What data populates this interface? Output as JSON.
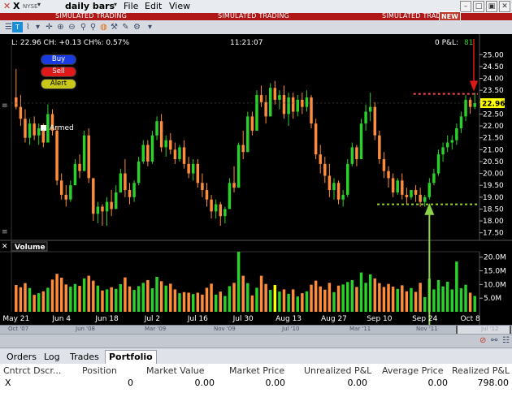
{
  "menu": {
    "symbol": "X",
    "exchange": "NYSE",
    "bar_type": "daily bars",
    "items": [
      "File",
      "Edit",
      "View"
    ]
  },
  "banner": {
    "text": "SIMULATED TRADING",
    "badge": "NEW"
  },
  "info": {
    "quote": "L: 22.96  CH: +0.13  CH%: 0.57%",
    "time": "11:21:07",
    "pnl_label": "0  P&L:",
    "pnl_value": "81"
  },
  "order_buttons": {
    "buy": "Buy",
    "sell": "Sell",
    "alert": "Alert",
    "armed": "Armed"
  },
  "colors": {
    "up": "#2bd12b",
    "down": "#ff8c3a",
    "highlight": "#ffff00",
    "resistance": "#ff4a4a",
    "support": "#9ad61f",
    "arrow_down": "#e01818",
    "arrow_up": "#8ad24a",
    "buy": "#1a3be0",
    "sell": "#e01a1a",
    "alert": "#c8c81a"
  },
  "price_axis": {
    "ticks": [
      "25.00",
      "24.50",
      "24.00",
      "23.50",
      "23.00",
      "22.50",
      "22.00",
      "21.50",
      "21.00",
      "20.50",
      "20.00",
      "19.50",
      "19.00",
      "18.50",
      "18.00",
      "17.50"
    ],
    "last_price_label": "22.96",
    "min": 17.25,
    "max": 25.25
  },
  "volume": {
    "label": "Volume",
    "ticks": [
      "20.0M",
      "15.0M",
      "10.0M",
      "5.0M"
    ],
    "max": 22
  },
  "x_labels": [
    "May 21",
    "Jun 4",
    "Jun 18",
    "Jul 2",
    "Jul 16",
    "Jul 30",
    "Aug 13",
    "Aug 27",
    "Sep 10",
    "Sep 24",
    "Oct 8"
  ],
  "navigator": {
    "labels": [
      "Oct '07",
      "Jun '08",
      "Mar '09",
      "Nov '09",
      "Jul '10",
      "Mar '11",
      "Nov '11",
      "Jul '12"
    ]
  },
  "portfolio": {
    "tabs": [
      "Orders",
      "Log",
      "Trades",
      "Portfolio"
    ],
    "active_tab": "Portfolio",
    "headers": [
      "Cntrct Dscr...",
      "Position",
      "Market Value",
      "Market Price",
      "Unrealized P&L",
      "Average Price",
      "Realized P&L"
    ],
    "row": [
      "X",
      "0",
      "0.00",
      "0.00",
      "0.00",
      "0.00",
      "798.00"
    ]
  },
  "chart_data": {
    "type": "candlestick",
    "resistance": 23.35,
    "support": 18.7,
    "candles": [
      [
        23.2,
        24.4,
        22.7,
        22.8,
        9.8
      ],
      [
        22.8,
        23.3,
        22.0,
        22.3,
        9.0
      ],
      [
        22.3,
        22.7,
        21.3,
        21.5,
        10.5
      ],
      [
        21.5,
        22.3,
        21.2,
        22.1,
        8.7
      ],
      [
        22.1,
        22.4,
        21.4,
        21.6,
        6.2
      ],
      [
        21.6,
        22.1,
        21.2,
        21.9,
        6.8
      ],
      [
        21.9,
        22.1,
        21.1,
        21.3,
        7.5
      ],
      [
        21.3,
        22.9,
        21.3,
        22.5,
        8.8
      ],
      [
        22.5,
        22.7,
        21.6,
        21.8,
        11.8
      ],
      [
        21.8,
        22.0,
        19.5,
        19.7,
        13.9
      ],
      [
        19.7,
        20.0,
        18.9,
        19.1,
        12.5
      ],
      [
        19.1,
        19.5,
        18.6,
        18.9,
        10.0
      ],
      [
        18.9,
        19.7,
        18.8,
        19.5,
        9.2
      ],
      [
        19.5,
        20.6,
        19.5,
        20.4,
        10.2
      ],
      [
        20.4,
        20.8,
        19.8,
        20.1,
        9.5
      ],
      [
        20.1,
        21.8,
        20.1,
        21.6,
        12.2
      ],
      [
        21.6,
        21.9,
        19.6,
        19.8,
        13.2
      ],
      [
        19.8,
        19.8,
        18.0,
        18.3,
        11.4
      ],
      [
        18.3,
        18.8,
        17.9,
        18.6,
        9.6
      ],
      [
        18.6,
        18.7,
        17.8,
        18.4,
        7.8
      ],
      [
        18.4,
        19.0,
        17.8,
        18.8,
        8.2
      ],
      [
        18.8,
        19.3,
        18.2,
        18.5,
        9.0
      ],
      [
        18.5,
        19.5,
        18.5,
        19.2,
        8.4
      ],
      [
        19.2,
        20.2,
        19.2,
        20.0,
        10.1
      ],
      [
        20.0,
        20.6,
        19.0,
        19.3,
        12.6
      ],
      [
        19.3,
        19.6,
        18.7,
        19.0,
        9.3
      ],
      [
        19.0,
        19.7,
        18.8,
        19.6,
        8.0
      ],
      [
        19.6,
        20.7,
        19.5,
        20.5,
        9.4
      ],
      [
        20.5,
        21.4,
        20.4,
        21.2,
        10.6
      ],
      [
        21.2,
        21.4,
        20.3,
        20.5,
        11.6
      ],
      [
        20.5,
        21.8,
        20.4,
        21.6,
        8.6
      ],
      [
        21.6,
        22.4,
        21.4,
        22.2,
        12.8
      ],
      [
        22.2,
        22.5,
        20.9,
        21.1,
        11.2
      ],
      [
        21.1,
        21.6,
        20.7,
        21.4,
        9.6
      ],
      [
        21.4,
        21.7,
        20.8,
        21.0,
        10.3
      ],
      [
        21.0,
        21.3,
        20.4,
        20.6,
        8.2
      ],
      [
        20.6,
        21.2,
        20.5,
        21.1,
        6.8
      ],
      [
        21.1,
        21.4,
        20.2,
        20.4,
        7.2
      ],
      [
        20.4,
        20.7,
        19.8,
        20.0,
        7.0
      ],
      [
        20.0,
        20.6,
        19.7,
        20.4,
        6.5
      ],
      [
        20.4,
        20.6,
        19.4,
        19.6,
        7.0
      ],
      [
        19.6,
        20.0,
        19.0,
        19.3,
        6.3
      ],
      [
        19.3,
        19.6,
        18.6,
        18.9,
        8.8
      ],
      [
        18.9,
        19.1,
        18.1,
        18.4,
        10.3
      ],
      [
        18.4,
        18.9,
        18.1,
        18.7,
        6.3
      ],
      [
        18.7,
        18.8,
        17.8,
        18.2,
        7.4
      ],
      [
        18.2,
        18.6,
        17.9,
        18.5,
        5.8
      ],
      [
        18.5,
        19.8,
        18.5,
        19.6,
        9.4
      ],
      [
        19.6,
        20.3,
        19.2,
        19.4,
        10.6
      ],
      [
        19.4,
        21.3,
        19.4,
        21.2,
        22.0
      ],
      [
        21.2,
        21.8,
        20.6,
        20.9,
        13.2
      ],
      [
        20.9,
        22.6,
        20.9,
        22.4,
        10.5
      ],
      [
        22.4,
        22.6,
        21.6,
        21.8,
        6.0
      ],
      [
        21.8,
        23.5,
        21.8,
        23.3,
        8.8
      ],
      [
        23.3,
        23.7,
        22.8,
        23.0,
        13.2
      ],
      [
        23.0,
        23.3,
        22.1,
        22.4,
        10.2
      ],
      [
        22.4,
        23.8,
        22.4,
        23.6,
        8.0
      ],
      [
        23.6,
        23.9,
        22.9,
        23.1,
        9.8
      ],
      [
        23.1,
        23.5,
        22.7,
        23.3,
        7.4
      ],
      [
        23.3,
        23.7,
        22.3,
        22.5,
        8.2
      ],
      [
        22.5,
        23.4,
        22.0,
        23.2,
        6.6
      ],
      [
        23.2,
        23.4,
        22.3,
        22.6,
        8.2
      ],
      [
        22.6,
        23.3,
        22.4,
        23.1,
        5.6
      ],
      [
        23.1,
        23.4,
        22.5,
        22.8,
        6.8
      ],
      [
        22.8,
        23.5,
        22.6,
        23.2,
        7.5
      ],
      [
        23.2,
        23.3,
        21.9,
        22.1,
        9.9
      ],
      [
        22.1,
        22.3,
        20.6,
        20.8,
        11.4
      ],
      [
        20.8,
        21.2,
        20.0,
        20.4,
        9.3
      ],
      [
        20.4,
        20.7,
        19.6,
        19.9,
        8.1
      ],
      [
        19.9,
        20.4,
        19.0,
        19.3,
        10.6
      ],
      [
        19.3,
        19.8,
        18.9,
        19.6,
        7.2
      ],
      [
        19.6,
        19.7,
        18.7,
        18.9,
        9.6
      ],
      [
        18.9,
        19.3,
        18.6,
        19.1,
        10.0
      ],
      [
        19.1,
        20.6,
        19.0,
        20.4,
        10.9
      ],
      [
        20.4,
        21.3,
        20.3,
        21.1,
        11.6
      ],
      [
        21.1,
        21.2,
        20.3,
        20.6,
        9.1
      ],
      [
        20.6,
        22.3,
        20.6,
        22.1,
        14.4
      ],
      [
        22.1,
        22.9,
        21.8,
        22.6,
        10.6
      ],
      [
        22.6,
        23.4,
        22.2,
        22.8,
        13.7
      ],
      [
        22.8,
        23.0,
        21.4,
        21.6,
        12.2
      ],
      [
        21.6,
        21.8,
        20.4,
        20.6,
        10.5
      ],
      [
        20.6,
        20.9,
        19.8,
        20.1,
        9.1
      ],
      [
        20.1,
        20.3,
        19.4,
        19.8,
        10.2
      ],
      [
        19.8,
        20.0,
        19.0,
        19.2,
        9.2
      ],
      [
        19.2,
        19.8,
        19.1,
        19.7,
        8.4
      ],
      [
        19.7,
        20.0,
        18.9,
        19.1,
        9.7
      ],
      [
        19.1,
        19.4,
        18.7,
        19.0,
        7.5
      ],
      [
        19.0,
        19.3,
        18.9,
        19.3,
        8.7
      ],
      [
        19.3,
        19.5,
        18.8,
        19.1,
        7.3
      ],
      [
        19.1,
        19.4,
        18.6,
        18.8,
        10.6
      ],
      [
        18.8,
        19.1,
        18.6,
        19.0,
        5.4
      ],
      [
        19.0,
        19.8,
        18.9,
        19.6,
        12.1
      ],
      [
        19.6,
        20.2,
        19.5,
        20.0,
        8.2
      ],
      [
        20.0,
        21.0,
        19.9,
        20.8,
        11.6
      ],
      [
        20.8,
        21.3,
        20.5,
        21.1,
        9.3
      ],
      [
        21.1,
        21.6,
        20.9,
        21.3,
        11.0
      ],
      [
        21.3,
        21.6,
        21.0,
        21.4,
        8.2
      ],
      [
        21.4,
        22.1,
        21.2,
        21.9,
        18.4
      ],
      [
        21.9,
        22.6,
        21.7,
        22.4,
        8.6
      ],
      [
        22.4,
        23.3,
        22.2,
        23.1,
        9.9
      ],
      [
        23.1,
        23.2,
        22.5,
        22.8,
        7.0
      ],
      [
        22.8,
        23.4,
        22.7,
        22.96,
        5.8
      ]
    ]
  }
}
